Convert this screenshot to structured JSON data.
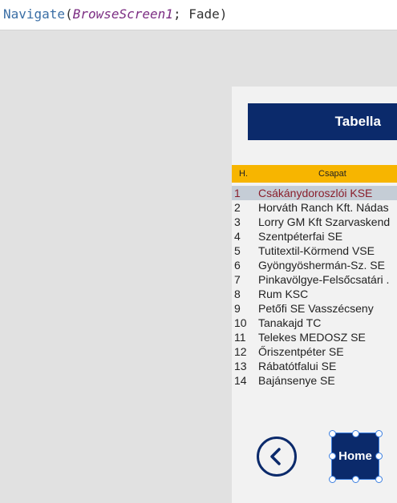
{
  "formula": {
    "function": "Navigate",
    "open_paren": "(",
    "screen_arg": "BrowseScreen1",
    "separator": "; ",
    "transition": "Fade",
    "close_paren": ")"
  },
  "screen": {
    "title": "Tabella",
    "table": {
      "headers": {
        "position": "H.",
        "team": "Csapat"
      },
      "rows": [
        {
          "position": "1",
          "team": "Csákánydoroszlói KSE",
          "selected": true
        },
        {
          "position": "2",
          "team": "Horváth Ranch Kft. Nádas"
        },
        {
          "position": "3",
          "team": "Lorry GM Kft Szarvaskend"
        },
        {
          "position": "4",
          "team": "Szentpéterfai SE"
        },
        {
          "position": "5",
          "team": "Tutitextil-Körmend VSE"
        },
        {
          "position": "6",
          "team": "Gyöngyöshermán-Sz. SE"
        },
        {
          "position": "7",
          "team": "Pinkavölgye-Felsőcsatári ."
        },
        {
          "position": "8",
          "team": "Rum KSC"
        },
        {
          "position": "9",
          "team": "Petőfi SE Vasszécseny"
        },
        {
          "position": "10",
          "team": "Tanakajd TC"
        },
        {
          "position": "11",
          "team": "Telekes MEDOSZ SE"
        },
        {
          "position": "12",
          "team": "Őriszentpéter SE"
        },
        {
          "position": "13",
          "team": "Rábatótfalui SE"
        },
        {
          "position": "14",
          "team": "Bajánsenye SE"
        }
      ]
    },
    "back_icon": "chevron-left-icon",
    "home_label": "Home"
  },
  "colors": {
    "title_bar": "#0b2a6b",
    "header": "#f7b500",
    "selected_row_bg": "#c5cdd6",
    "selected_row_text": "#8a1f2c",
    "selection_handle": "#3b7fe0"
  }
}
